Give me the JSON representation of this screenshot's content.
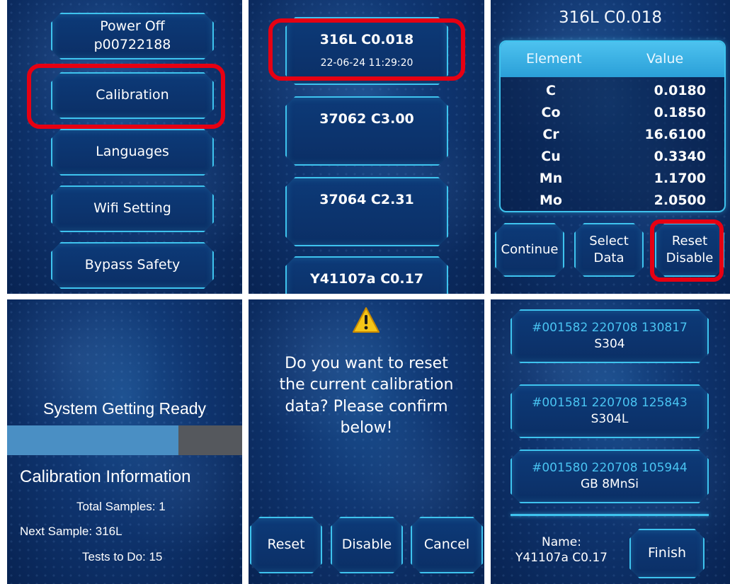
{
  "panel1": {
    "items": [
      {
        "line1": "Power Off",
        "line2": "p00722188"
      },
      {
        "line1": "Calibration"
      },
      {
        "line1": "Languages"
      },
      {
        "line1": "Wifi Setting"
      },
      {
        "line1": "Bypass Safety"
      }
    ]
  },
  "panel2": {
    "items": [
      {
        "name": "316L C0.018",
        "date": "22-06-24 11:29:20"
      },
      {
        "name": "37062 C3.00"
      },
      {
        "name": "37064 C2.31"
      },
      {
        "name": "Y41107a C0.17"
      }
    ]
  },
  "panel3": {
    "title": "316L C0.018",
    "headers": {
      "element": "Element",
      "value": "Value"
    },
    "rows": [
      {
        "element": "C",
        "value": "0.0180"
      },
      {
        "element": "Co",
        "value": "0.1850"
      },
      {
        "element": "Cr",
        "value": "16.6100"
      },
      {
        "element": "Cu",
        "value": "0.3340"
      },
      {
        "element": "Mn",
        "value": "1.1700"
      },
      {
        "element": "Mo",
        "value": "2.0500"
      }
    ],
    "buttons": {
      "continue": "Continue",
      "select_line1": "Select",
      "select_line2": "Data",
      "reset_line1": "Reset",
      "reset_line2": "Disable"
    }
  },
  "panel4": {
    "status": "System Getting Ready",
    "progress": 0.73,
    "info_title": "Calibration Information",
    "total_samples": "Total Samples: 1",
    "next_sample": "Next Sample: 316L",
    "tests_to_do": "Tests to Do: 15"
  },
  "panel5": {
    "warning_icon": "warning-icon",
    "message_line1": "Do you want to reset",
    "message_line2": "the current calibration",
    "message_line3": "data? Please confirm",
    "message_line4": "below!",
    "buttons": {
      "reset": "Reset",
      "disable": "Disable",
      "cancel": "Cancel"
    }
  },
  "panel6": {
    "records": [
      {
        "id": "#001582  220708 130817",
        "name": "S304"
      },
      {
        "id": "#001581  220708 125843",
        "name": "S304L"
      },
      {
        "id": "#001580  220708 105944",
        "name": "GB 8MnSi"
      }
    ],
    "name_label": "Name:",
    "name_value": "Y41107a C0.17",
    "finish": "Finish"
  },
  "colors": {
    "accent": "#3ec3ee",
    "highlight": "#e60012",
    "record_id": "#49c4f2",
    "progress_fill": "#4a8fc4",
    "progress_track": "#55585d"
  }
}
